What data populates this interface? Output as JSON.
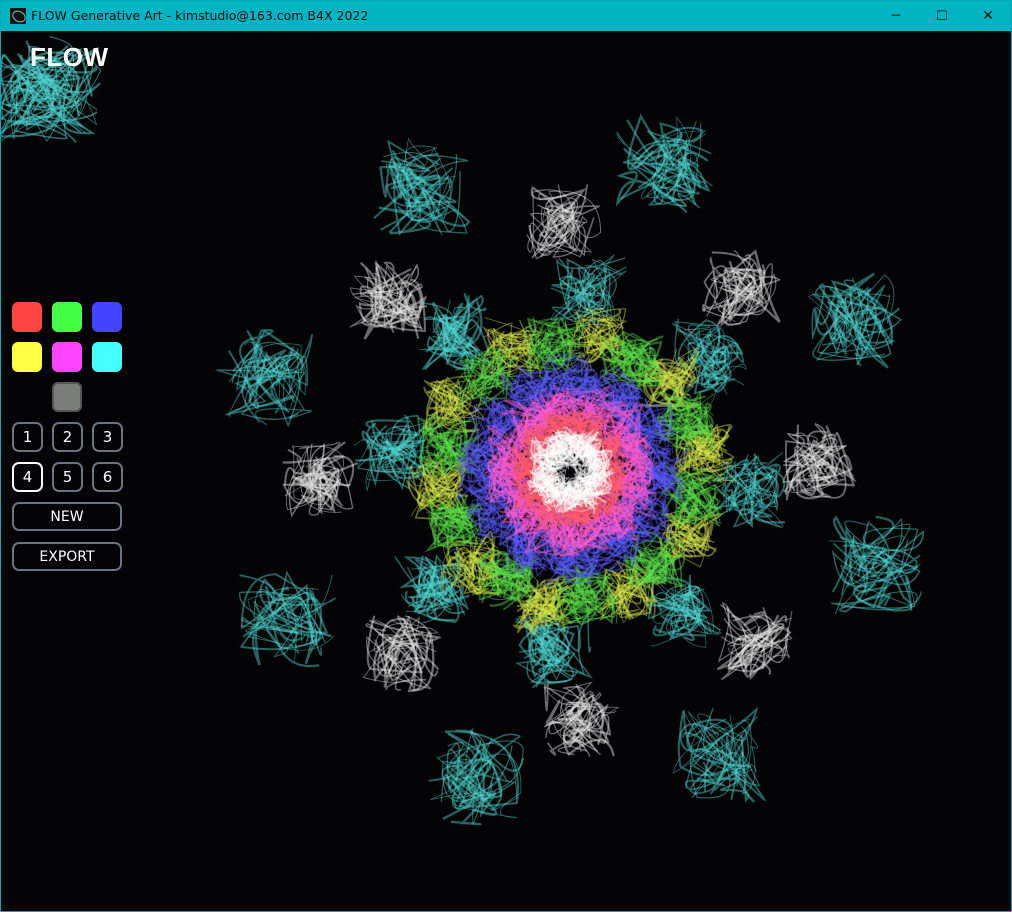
{
  "window": {
    "title": "FLOW Generative Art - kimstudio@163.com B4X 2022",
    "minimize_icon": "─",
    "maximize_icon": "☐",
    "close_icon": "✕"
  },
  "app": {
    "heading": "FLOW",
    "color_swatches": [
      {
        "name": "red",
        "color": "#ff4444"
      },
      {
        "name": "green",
        "color": "#44ff44"
      },
      {
        "name": "blue",
        "color": "#4444ff"
      },
      {
        "name": "yellow",
        "color": "#ffff44"
      },
      {
        "name": "magenta",
        "color": "#ff44ff"
      },
      {
        "name": "cyan",
        "color": "#44ffff"
      },
      {
        "name": "gray",
        "color": "#7a7d7a"
      }
    ],
    "symmetry_buttons": [
      "1",
      "2",
      "3",
      "4",
      "5",
      "6"
    ],
    "selected_symmetry": "4",
    "new_label": "NEW",
    "export_label": "EXPORT"
  }
}
